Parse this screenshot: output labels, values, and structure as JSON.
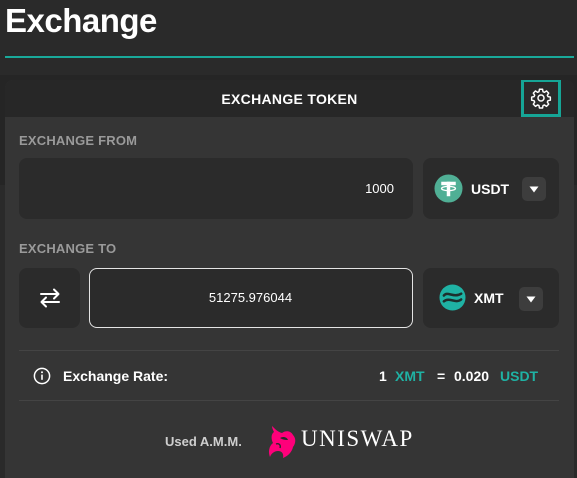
{
  "page": {
    "title": "Exchange"
  },
  "card": {
    "title": "EXCHANGE TOKEN",
    "settings_icon": "gear-icon"
  },
  "from": {
    "label": "EXCHANGE FROM",
    "amount": "1000",
    "token": {
      "symbol": "USDT",
      "icon": "tether-icon",
      "color": "#50af95"
    }
  },
  "to": {
    "label": "EXCHANGE TO",
    "amount": "51275.976044",
    "token": {
      "symbol": "XMT",
      "icon": "xmt-icon",
      "color": "#1fb2a4"
    }
  },
  "rate": {
    "label": "Exchange Rate:",
    "lhs_amount": "1",
    "lhs_token": "XMT",
    "equals": "=",
    "rhs_amount": "0.020",
    "rhs_token": "USDT"
  },
  "footer": {
    "amm_label": "Used A.M.M.",
    "brand": "UNISWAP"
  },
  "colors": {
    "accent": "#19a99a",
    "uniswap_pink": "#ff007a"
  }
}
